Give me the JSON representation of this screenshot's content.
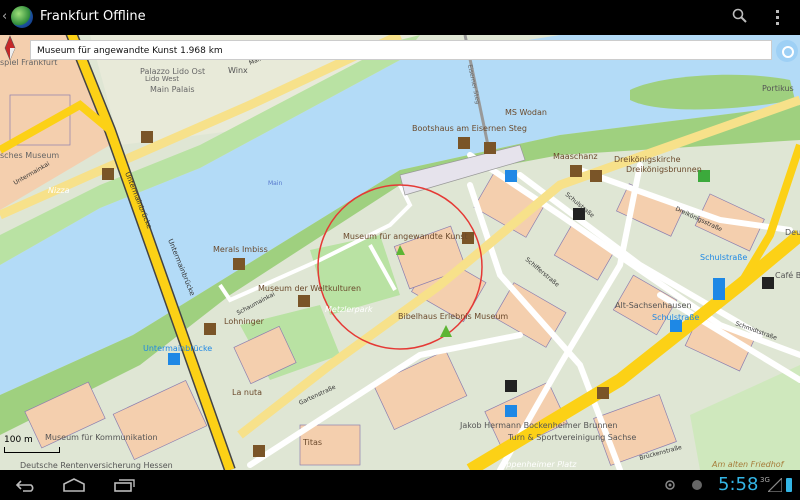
{
  "app": {
    "title": "Frankfurt Offline"
  },
  "destination": {
    "text": "Museum für angewandte Kunst 1.968 km"
  },
  "scale": {
    "label": "100 m"
  },
  "map_labels": {
    "palazzo": "Palazzo Lido Ost",
    "lido_west": "Lido West",
    "main_palais": "Main Palais",
    "mainkai": "Mainkai",
    "winx": "Winx",
    "spiel_frankfurt": "spiel Frankfurt",
    "sches_museum": "sches Museum",
    "untermainkai": "Untermainkai",
    "nizza": "Nizza",
    "main_river": "Main",
    "untermainbruecke1": "Untermainbrücke",
    "untermainbruecke2": "Untermainbrücke",
    "merals": "Merals Imbiss",
    "mak": "Museum für angewandte Kunst",
    "weltkulturen": "Museum der Weltkulturen",
    "metzlerpark": "Metzlerpark",
    "schaumainkai": "Schaumainkai",
    "lohninger": "Lohninger",
    "untermainbruecke_stop": "Untermainbrücke",
    "bibelhaus": "Bibelhaus Erlebnis Museum",
    "eiserner_steg": "Eiserner Steg",
    "ms_wodan": "MS Wodan",
    "bootshaus": "Bootshaus am Eisernen Steg",
    "maaschanz": "Maaschanz",
    "dreikoenigskirche": "Dreikönigskirche",
    "dreikoenigsbrunnen": "Dreikönigsbrunnen",
    "dreikoenigsstrasse": "Dreikönigsstraße",
    "portikus": "Portikus",
    "schulstrasse_stop1": "Schulstraße",
    "schulstrasse_stop2": "Schulstraße",
    "cafe": "Café Br",
    "alt_sachsenhausen": "Alt-Sachsenhausen",
    "schifferstrasse": "Schifferstraße",
    "schulstrasse": "Schulstraße",
    "schmidtstrasse": "Schmidtstraße",
    "la_nuta": "La nuta",
    "titas": "Titas",
    "kommunikation": "Museum für Kommunikation",
    "rentenversicherung": "Deutsche Rentenversicherung Hessen",
    "jakob": "Jakob Hermann Bockenheimer Brunnen",
    "turnverein": "Turn & Sportvereinigung Sachse",
    "oppenheimer": "Oppenheimer Platz",
    "friedhof": "Am alten Friedhof",
    "gartenstrasse": "Gartenstraße",
    "brueckenstrasse": "Brückenstraße",
    "deu": "Deu"
  },
  "status": {
    "time": "5:58",
    "network": "3G"
  },
  "colors": {
    "water": "#b3dbf7",
    "land": "#dfe6d4",
    "park": "#b9e2a3",
    "road": "#fcd116",
    "building": "#f4cfae",
    "accent": "#33b5e5",
    "circle": "#e53935"
  }
}
